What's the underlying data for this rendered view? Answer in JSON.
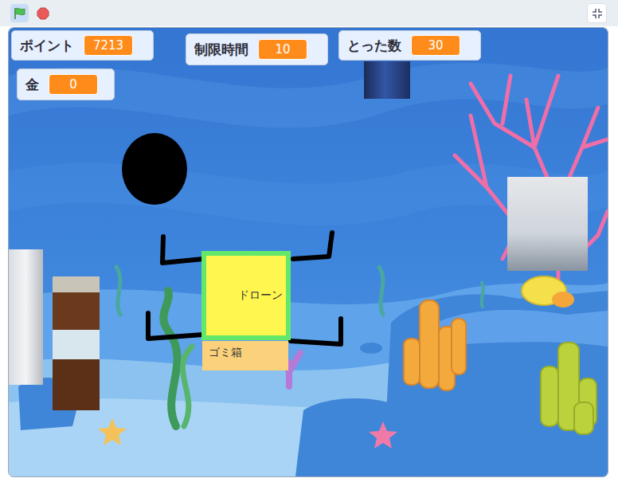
{
  "stage": {
    "monitors": [
      {
        "label": "ポイント",
        "value": "7213"
      },
      {
        "label": "制限時間",
        "value": "10"
      },
      {
        "label": "とった数",
        "value": "30"
      },
      {
        "label": "金",
        "value": "0"
      }
    ],
    "sprites": {
      "drone": "ドローン",
      "trash": "ゴミ箱"
    }
  }
}
